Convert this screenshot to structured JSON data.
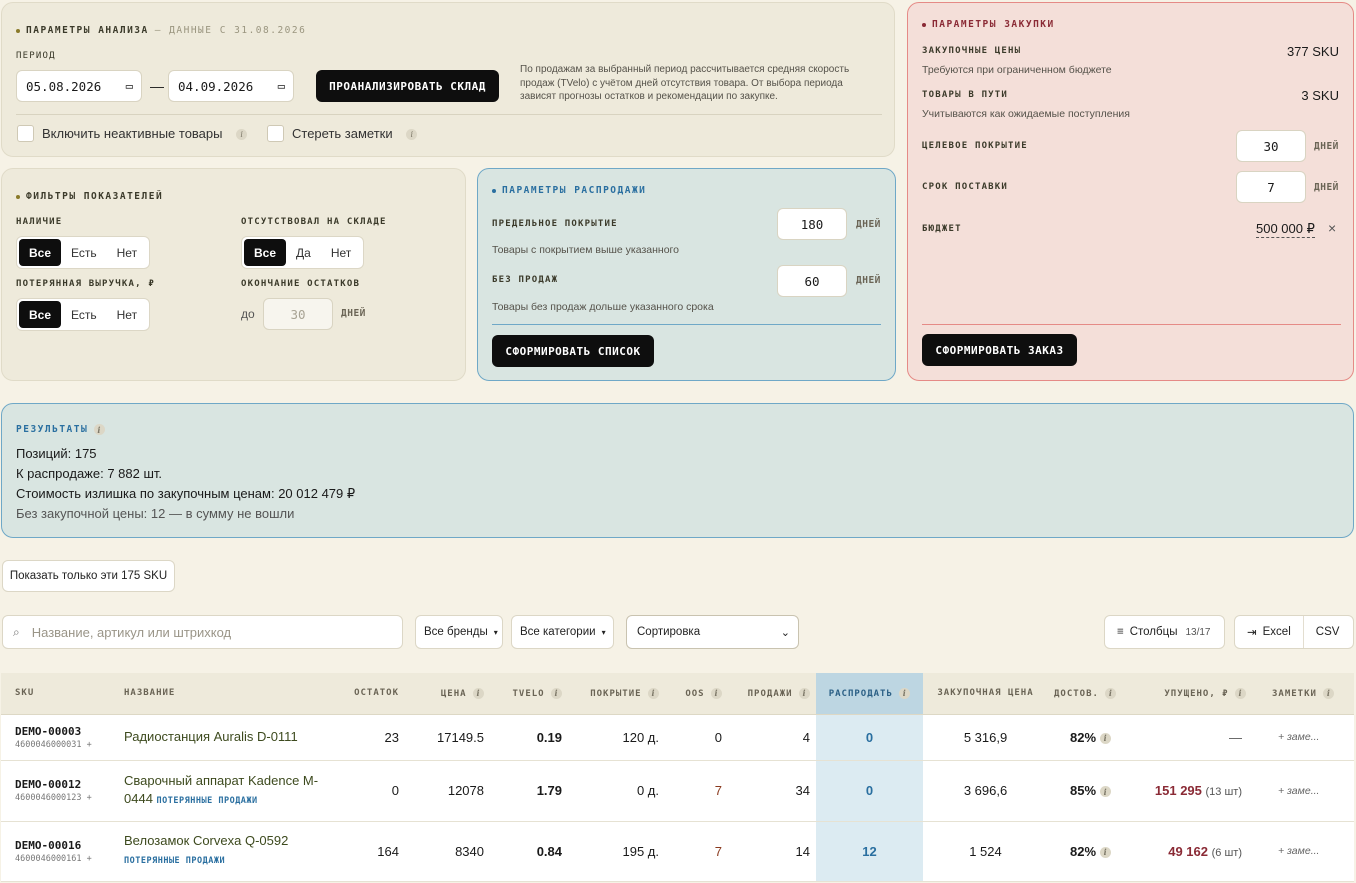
{
  "analysis": {
    "title": "ПАРАМЕТРЫ АНАЛИЗА",
    "data_since": "— ДАННЫЕ С 31.08.2026",
    "period_label": "ПЕРИОД",
    "date_from": "05.08.2026",
    "date_to": "04.09.2026",
    "dash": "—",
    "analyze_button": "ПРОАНАЛИЗИРОВАТЬ СКЛАД",
    "description": "По продажам за выбранный период рассчитывается средняя скорость продаж (TVelo) с учётом дней отсутствия товара. От выбора периода зависят прогнозы остатков и рекомендации по закупке.",
    "include_inactive": "Включить неактивные товары",
    "erase_notes": "Стереть заметки"
  },
  "filters": {
    "title": "ФИЛЬТРЫ ПОКАЗАТЕЛЕЙ",
    "availability": {
      "label": "НАЛИЧИЕ",
      "options": [
        "Все",
        "Есть",
        "Нет"
      ],
      "selected": "Все"
    },
    "out_of_stock": {
      "label": "ОТСУТСТВОВАЛ НА СКЛАДЕ",
      "options": [
        "Все",
        "Да",
        "Нет"
      ],
      "selected": "Все"
    },
    "lost_revenue": {
      "label": "ПОТЕРЯННАЯ ВЫРУЧКА, ₽",
      "options": [
        "Все",
        "Есть",
        "Нет"
      ],
      "selected": "Все"
    },
    "stock_end": {
      "label": "ОКОНЧАНИЕ ОСТАТКОВ",
      "prefix": "до",
      "placeholder": "30",
      "unit": "ДНЕЙ"
    }
  },
  "sale": {
    "title": "ПАРАМЕТРЫ РАСПРОДАЖИ",
    "max_cover_label": "ПРЕДЕЛЬНОЕ ПОКРЫТИЕ",
    "max_cover_value": "180",
    "max_cover_hint": "Товары с покрытием выше указанного",
    "no_sales_label": "БЕЗ ПРОДАЖ",
    "no_sales_value": "60",
    "no_sales_hint": "Товары без продаж дольше указанного срока",
    "unit": "ДНЕЙ",
    "button": "СФОРМИРОВАТЬ СПИСОК"
  },
  "purchase": {
    "title": "ПАРАМЕТРЫ ЗАКУПКИ",
    "prices_label": "ЗАКУПОЧНЫЕ ЦЕНЫ",
    "prices_value": "377 SKU",
    "prices_hint": "Требуются при ограниченном бюджете",
    "transit_label": "ТОВАРЫ В ПУТИ",
    "transit_value": "3 SKU",
    "transit_hint": "Учитываются как ожидаемые поступления",
    "target_cover_label": "ЦЕЛЕВОЕ ПОКРЫТИЕ",
    "target_cover_value": "30",
    "lead_time_label": "СРОК ПОСТАВКИ",
    "lead_time_value": "7",
    "unit": "ДНЕЙ",
    "budget_label": "БЮДЖЕТ",
    "budget_value": "500 000 ₽",
    "clear": "×",
    "button": "СФОРМИРОВАТЬ ЗАКАЗ"
  },
  "results": {
    "title": "РЕЗУЛЬТАТЫ",
    "positions": "Позиций: 175",
    "for_sale": "К распродаже: 7 882 шт.",
    "excess_cost": "Стоимость излишка по закупочным ценам: 20 012 479 ₽",
    "no_price": "Без закупочной цены: 12 — в сумму не вошли"
  },
  "show_only": "Показать только эти 175 SKU",
  "toolbar": {
    "search_placeholder": "Название, артикул или штрихкод",
    "brands": "Все бренды",
    "categories": "Все категории",
    "sort": "Сортировка",
    "columns": "Столбцы",
    "columns_count": "13/17",
    "excel": "Excel",
    "csv": "CSV"
  },
  "table": {
    "headers": [
      "SKU",
      "НАЗВАНИЕ",
      "ОСТАТОК",
      "ЦЕНА",
      "TVELO",
      "ПОКРЫТИЕ",
      "OOS",
      "ПРОДАЖИ",
      "РАСПРОДАТЬ",
      "ЗАКУПОЧНАЯ ЦЕНА",
      "ДОСТОВ.",
      "УПУЩЕНО, ₽",
      "ЗАМЕТКИ"
    ],
    "rows": [
      {
        "sku": "DEMO-00003",
        "barcode": "4600046000031 +",
        "name": "Радиостанция Auralis D-0111",
        "tag": "",
        "stock": "23",
        "price": "17149.5",
        "tvelo": "0.19",
        "cover": "120 д.",
        "oos": "0",
        "sales": "4",
        "sell": "0",
        "purchase_price": "5 316,9",
        "reliability": "82%",
        "lost": "—",
        "lost_qty": "",
        "note": "+ заме..."
      },
      {
        "sku": "DEMO-00012",
        "barcode": "4600046000123 +",
        "name": "Сварочный аппарат Kadence M-0444",
        "tag": "ПОТЕРЯННЫЕ ПРОДАЖИ",
        "stock": "0",
        "price": "12078",
        "tvelo": "1.79",
        "cover": "0 д.",
        "oos": "7",
        "sales": "34",
        "sell": "0",
        "purchase_price": "3 696,6",
        "reliability": "85%",
        "lost": "151 295",
        "lost_qty": "(13 шт)",
        "note": "+ заме..."
      },
      {
        "sku": "DEMO-00016",
        "barcode": "4600046000161 +",
        "name": "Велозамок Corvexa Q-0592",
        "tag": "ПОТЕРЯННЫЕ ПРОДАЖИ",
        "stock": "164",
        "price": "8340",
        "tvelo": "0.84",
        "cover": "195 д.",
        "oos": "7",
        "sales": "14",
        "sell": "12",
        "purchase_price": "1 524",
        "reliability": "82%",
        "lost": "49 162",
        "lost_qty": "(6 шт)",
        "note": "+ заме..."
      }
    ]
  },
  "colors": {
    "accent_blue": "#2a6fa0",
    "accent_red": "#8a2a35",
    "oos_brown": "#8a3a1e"
  }
}
